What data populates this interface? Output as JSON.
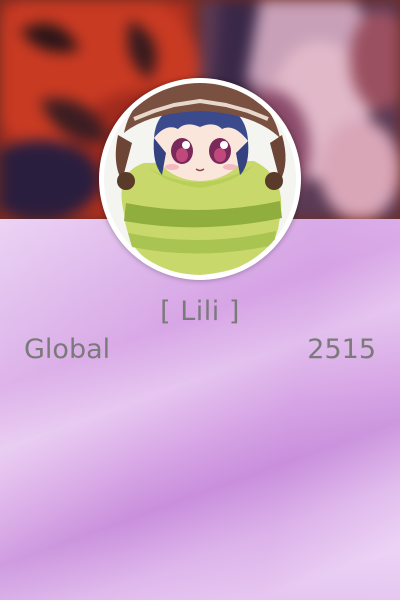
{
  "profile": {
    "username": "[ Lili ]",
    "avatar_icon": "chibi-character-avatar",
    "banner_image": "blurred-anime-banner"
  },
  "stats": {
    "label": "Global",
    "value": "2515"
  },
  "colors": {
    "text": "#7a7a7a",
    "panel_base": "#e3c4ee",
    "banner_base": "#6e2a22",
    "avatar_border": "#ffffff"
  }
}
